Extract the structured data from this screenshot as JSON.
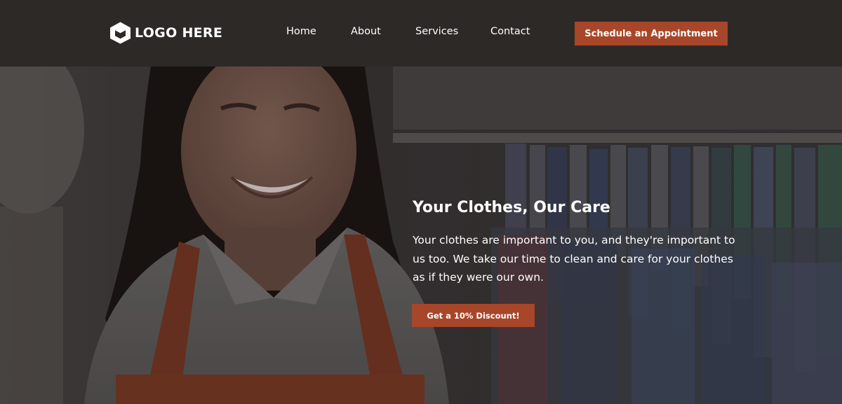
{
  "nav": {
    "logo_icon": "hexagon-logo-icon",
    "logo_text": "LOGO HERE",
    "links": [
      "Home",
      "About",
      "Services",
      "Contact"
    ],
    "cta_label": "Schedule an Appointment"
  },
  "hero": {
    "title": "Your Clothes, Our Care",
    "body": "Your clothes are important to you, and they're important to us too. We take our time to clean and care for your clothes as if they were our own.",
    "cta_label": "Get a 10% Discount!"
  },
  "colors": {
    "nav_background": "#2d2927",
    "accent": "#a8462a",
    "text": "#ffffff"
  }
}
